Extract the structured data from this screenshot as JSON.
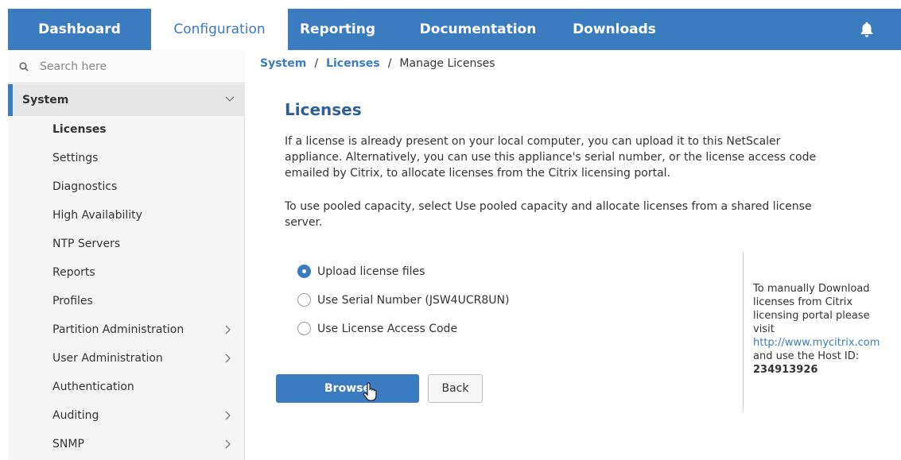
{
  "topnav": {
    "tabs": [
      {
        "label": "Dashboard"
      },
      {
        "label": "Configuration"
      },
      {
        "label": "Reporting"
      },
      {
        "label": "Documentation"
      },
      {
        "label": "Downloads"
      }
    ],
    "active_tab": "Configuration",
    "accent": "#3b7bbf",
    "notification_icon": "bell-icon"
  },
  "sidebar": {
    "search": {
      "placeholder": "Search here",
      "value": ""
    },
    "section": {
      "label": "System",
      "expanded": true
    },
    "items": [
      {
        "label": "Licenses",
        "active": true,
        "has_children": false
      },
      {
        "label": "Settings",
        "has_children": false
      },
      {
        "label": "Diagnostics",
        "has_children": false
      },
      {
        "label": "High Availability",
        "has_children": false
      },
      {
        "label": "NTP Servers",
        "has_children": false
      },
      {
        "label": "Reports",
        "has_children": false
      },
      {
        "label": "Profiles",
        "has_children": false
      },
      {
        "label": "Partition Administration",
        "has_children": true
      },
      {
        "label": "User Administration",
        "has_children": true
      },
      {
        "label": "Authentication",
        "has_children": false
      },
      {
        "label": "Auditing",
        "has_children": true
      },
      {
        "label": "SNMP",
        "has_children": true
      }
    ]
  },
  "breadcrumb": {
    "items": [
      "System",
      "Licenses"
    ],
    "separator": "/",
    "current": "Manage Licenses"
  },
  "main": {
    "title": "Licenses",
    "intro_lines": [
      "If a license is already present on your local computer, you can upload it to this NetScaler",
      "appliance. Alternatively, you can use this appliance's serial number, or the license access code",
      "emailed by Citrix, to allocate licenses from the Citrix licensing portal."
    ],
    "pooled_lines": [
      "To use pooled capacity, select Use pooled capacity and allocate licenses from a shared license",
      "server."
    ],
    "options": [
      {
        "label": "Upload license files",
        "checked": true
      },
      {
        "label": "Use Serial Number (JSW4UCR8UN)",
        "checked": false
      },
      {
        "label": "Use License Access Code",
        "checked": false
      }
    ],
    "browse_label": "Browse",
    "back_label": "Back"
  },
  "side_note": {
    "lines": [
      "To manually Download",
      "licenses from Citrix",
      "licensing portal please",
      "visit"
    ],
    "link": "http://www.mycitrix.com",
    "host_text": "and use the Host ID:",
    "host_id": "234913926"
  }
}
